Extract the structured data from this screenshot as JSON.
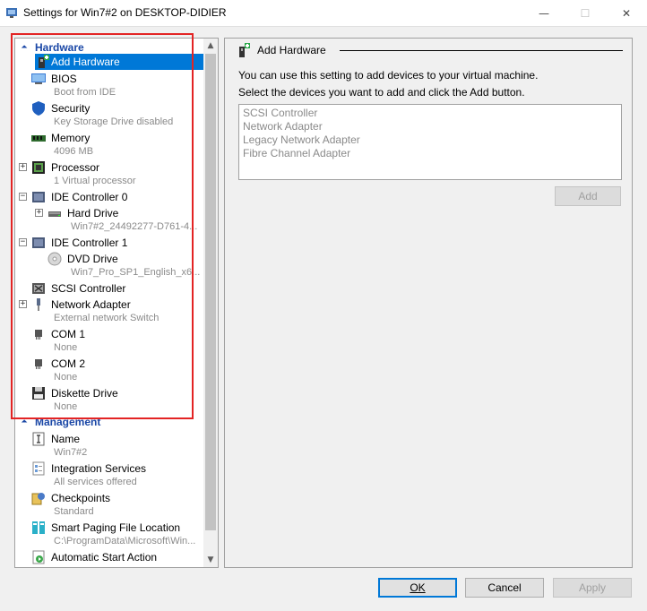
{
  "window": {
    "title": "Settings for Win7#2 on DESKTOP-DIDIER",
    "minimize": "—",
    "maximize": "☐",
    "close": "✕"
  },
  "tree": {
    "hardware_header": "Hardware",
    "management_header": "Management",
    "items": [
      {
        "label": "Add Hardware",
        "sub": ""
      },
      {
        "label": "BIOS",
        "sub": "Boot from IDE"
      },
      {
        "label": "Security",
        "sub": "Key Storage Drive disabled"
      },
      {
        "label": "Memory",
        "sub": "4096 MB"
      },
      {
        "label": "Processor",
        "sub": "1 Virtual processor"
      },
      {
        "label": "IDE Controller 0",
        "sub": ""
      },
      {
        "label": "Hard Drive",
        "sub": "Win7#2_24492277-D761-4..."
      },
      {
        "label": "IDE Controller 1",
        "sub": ""
      },
      {
        "label": "DVD Drive",
        "sub": "Win7_Pro_SP1_English_x6..."
      },
      {
        "label": "SCSI Controller",
        "sub": ""
      },
      {
        "label": "Network Adapter",
        "sub": "External network Switch"
      },
      {
        "label": "COM 1",
        "sub": "None"
      },
      {
        "label": "COM 2",
        "sub": "None"
      },
      {
        "label": "Diskette Drive",
        "sub": "None"
      }
    ],
    "management_items": [
      {
        "label": "Name",
        "sub": "Win7#2"
      },
      {
        "label": "Integration Services",
        "sub": "All services offered"
      },
      {
        "label": "Checkpoints",
        "sub": "Standard"
      },
      {
        "label": "Smart Paging File Location",
        "sub": "C:\\ProgramData\\Microsoft\\Win..."
      },
      {
        "label": "Automatic Start Action",
        "sub": ""
      }
    ]
  },
  "panel": {
    "title": "Add Hardware",
    "desc1": "You can use this setting to add devices to your virtual machine.",
    "desc2": "Select the devices you want to add and click the Add button.",
    "devices": [
      "SCSI Controller",
      "Network Adapter",
      "Legacy Network Adapter",
      "Fibre Channel Adapter"
    ],
    "add_label": "Add"
  },
  "buttons": {
    "ok": "OK",
    "cancel": "Cancel",
    "apply": "Apply"
  }
}
